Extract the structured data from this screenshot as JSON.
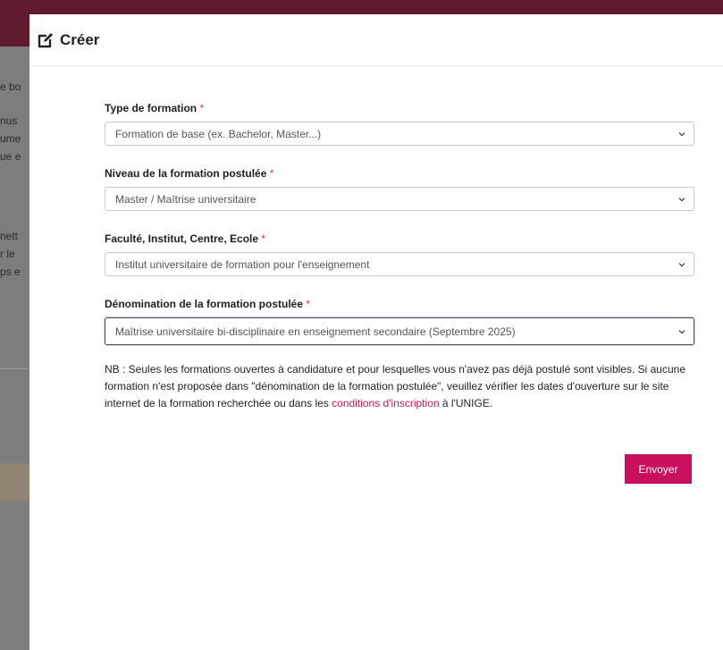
{
  "background": {
    "fragments": [
      "e bo",
      "nus",
      "ume",
      "ue e",
      "nett",
      "r le",
      "ps e"
    ]
  },
  "modal": {
    "title": "Créer",
    "icon": "edit-icon",
    "fields": [
      {
        "label": "Type de formation",
        "required": "*",
        "value": "Formation de base (ex. Bachelor, Master...)"
      },
      {
        "label": "Niveau de la formation postulée",
        "required": "*",
        "value": "Master / Maîtrise universitaire"
      },
      {
        "label": "Faculté, Institut, Centre, Ecole",
        "required": "*",
        "value": "Institut universitaire de formation pour l'enseignement"
      },
      {
        "label": "Dénomination de la formation postulée",
        "required": "*",
        "value": "Maîtrise universitaire bi-disciplinaire en enseignement secondaire (Septembre 2025)"
      }
    ],
    "note": {
      "text_before": "NB : Seules les formations ouvertes à candidature et pour lesquelles vous n'avez pas déjà postulé sont visibles. Si aucune formation n'est proposée dans \"dénomination de la formation postulée\", veuillez vérifier les dates d'ouverture sur le site internet de la formation recherchée ou dans les ",
      "link": "conditions d'inscription",
      "text_after": " à l'UNIGE."
    },
    "submit_label": "Envoyer"
  },
  "colors": {
    "accent": "#c8105f",
    "link": "#c2185b",
    "required": "#d6336c",
    "topbar": "#5e1b2d"
  }
}
